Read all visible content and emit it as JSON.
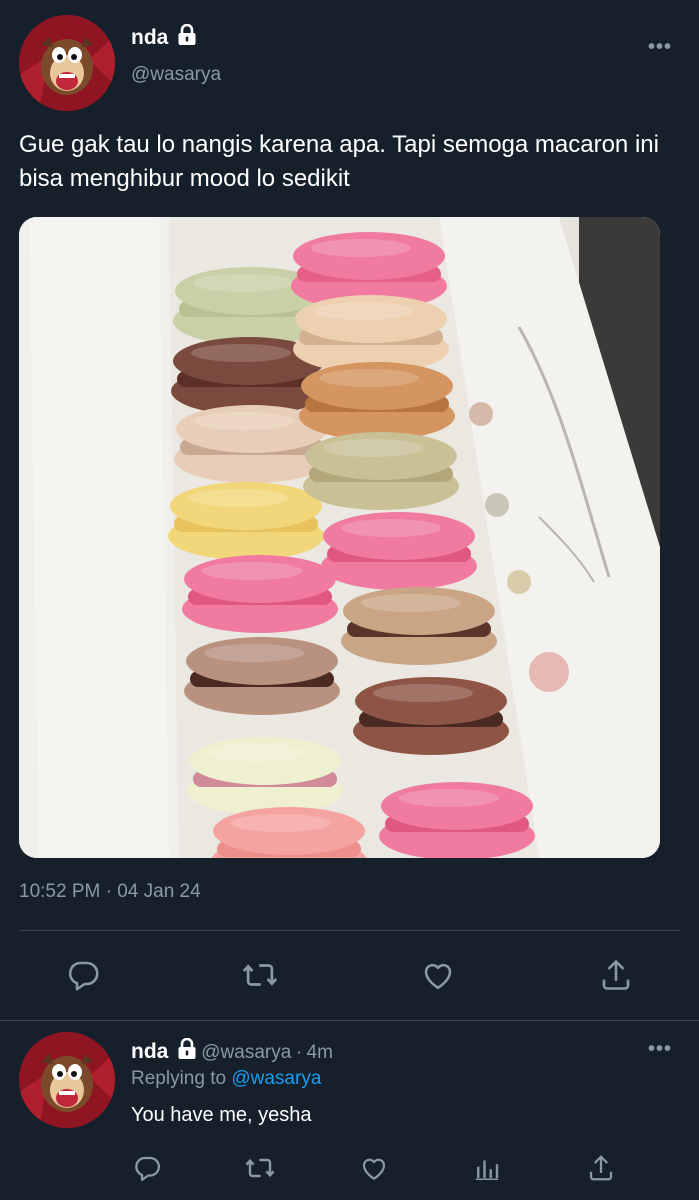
{
  "tweet": {
    "author_name": "nda",
    "author_handle": "@wasarya",
    "text": "Gue gak tau lo nangis karena apa. Tapi semoga macaron ini bisa menghibur mood lo sedikit",
    "time": "10:52 PM",
    "separator": "·",
    "date": "04 Jan 24",
    "more_label": "•••",
    "avatar_icon": "taz-avatar-icon",
    "lock_icon": "lock-icon",
    "media_description": "macaron-box-photo"
  },
  "actions": {
    "reply_icon": "reply-icon",
    "retweet_icon": "retweet-icon",
    "like_icon": "heart-icon",
    "share_icon": "share-icon"
  },
  "reply": {
    "author_name": "nda",
    "author_handle": "@wasarya",
    "separator": "·",
    "age": "4m",
    "replying_to_prefix": "Replying to",
    "replying_to_handle": "@wasarya",
    "text": "You have me, yesha",
    "more_label": "•••",
    "actions": {
      "reply_icon": "reply-icon",
      "retweet_icon": "retweet-icon",
      "like_icon": "heart-icon",
      "analytics_icon": "analytics-icon",
      "share_icon": "share-icon"
    }
  },
  "colors": {
    "background": "#15202b",
    "text": "#ffffff",
    "muted": "#8b98a5",
    "divider": "#38444d",
    "link": "#1d9bf0"
  }
}
